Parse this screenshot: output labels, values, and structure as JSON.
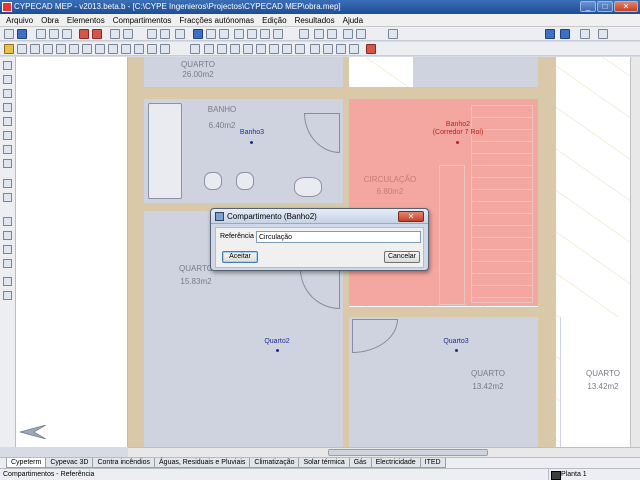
{
  "window": {
    "title": "CYPECAD MEP - v2013.beta.b - [C:\\CYPE Ingenieros\\Projectos\\CYPECAD MEP\\obra.mep]",
    "minimize": "_",
    "maximize": "□",
    "close": "✕"
  },
  "menu": [
    "Arquivo",
    "Obra",
    "Elementos",
    "Compartimentos",
    "Fracções autónomas",
    "Edição",
    "Resultados",
    "Ajuda"
  ],
  "plan": {
    "rooms": [
      {
        "label": "QUARTO",
        "area": "26.00m2"
      },
      {
        "label": "BANHO",
        "area": "6.40m2",
        "name": "Banho3"
      },
      {
        "label": "CIRCULAÇÃO",
        "area": "6.80m2",
        "name": "Banho2",
        "subname": "(Corredor 7 Rol)"
      },
      {
        "label": "QUARTO",
        "area": "15.83m2"
      },
      {
        "name": "Quarto2"
      },
      {
        "name": "Quarto3",
        "label": "QUARTO",
        "area": "13.42m2"
      },
      {
        "label": "QUARTO",
        "area": "13.42m2"
      }
    ]
  },
  "dialog": {
    "title": "Compartimento (Banho2)",
    "close": "✕",
    "field_label": "Referência",
    "field_value": "Circulação",
    "accept": "Aceitar",
    "cancel": "Cancelar"
  },
  "tabs": [
    "Cypeterm",
    "Cypevac 3D",
    "Contra incêndios",
    "Águas, Residuais e Pluviais",
    "Climatização",
    "Solar térmica",
    "Gás",
    "Electricidade",
    "ITED"
  ],
  "status": {
    "left": "Compartimentos - Referência",
    "floor": "Planta 1"
  },
  "colors": {
    "selected_room": "#f4a7a1",
    "room_fill": "#cfd3df",
    "wall": "#d9c9a9",
    "room_name": "#1f2d9e"
  }
}
